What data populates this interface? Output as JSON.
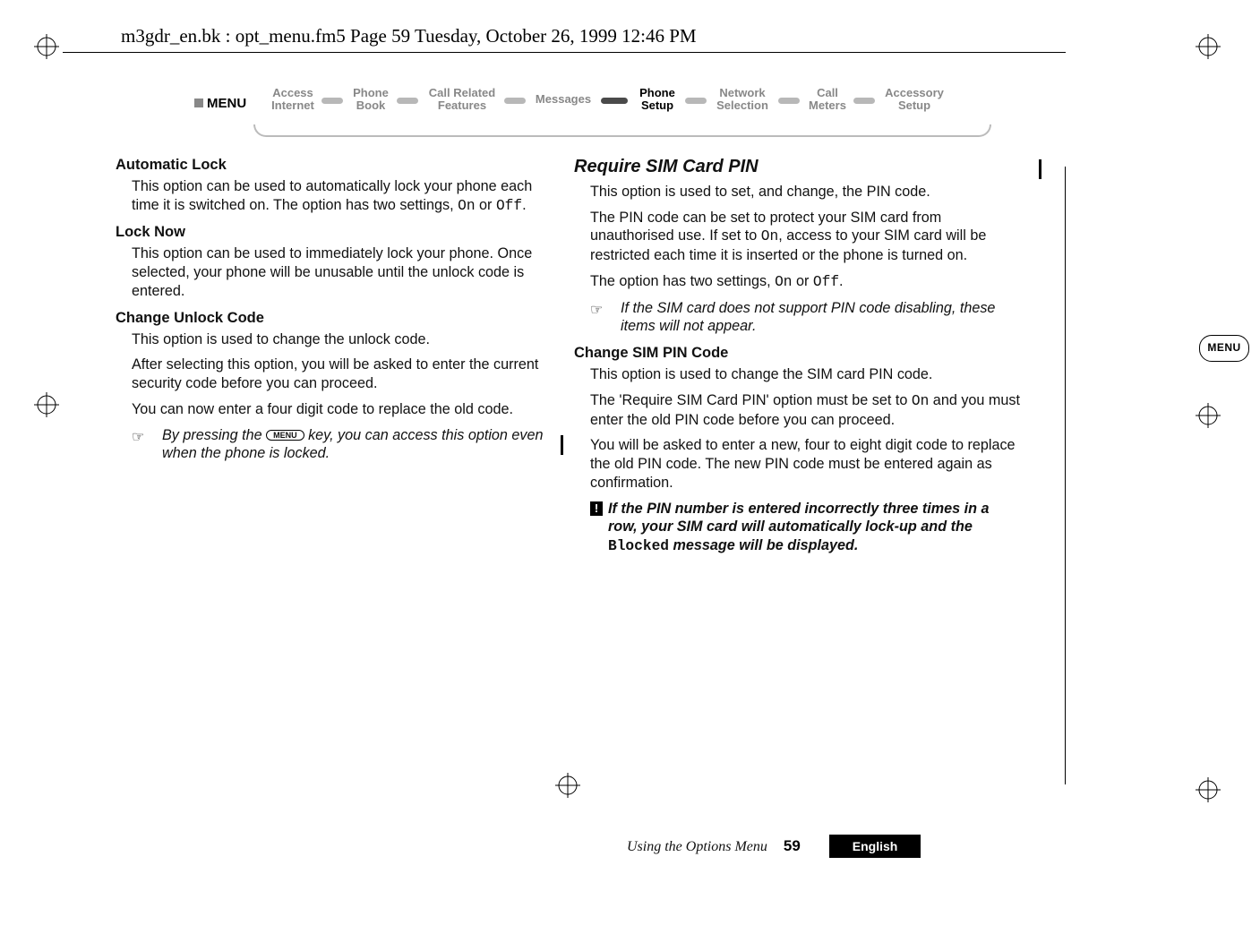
{
  "header": {
    "path_text": "m3gdr_en.bk : opt_menu.fm5  Page 59  Tuesday, October 26, 1999  12:46 PM"
  },
  "menubar": {
    "label": "MENU",
    "items": [
      {
        "l1": "Access",
        "l2": "Internet"
      },
      {
        "l1": "Phone",
        "l2": "Book"
      },
      {
        "l1": "Call Related",
        "l2": "Features"
      },
      {
        "l1": "Messages",
        "l2": ""
      },
      {
        "l1": "Phone",
        "l2": "Setup"
      },
      {
        "l1": "Network",
        "l2": "Selection"
      },
      {
        "l1": "Call",
        "l2": "Meters"
      },
      {
        "l1": "Accessory",
        "l2": "Setup"
      }
    ]
  },
  "left": {
    "h1": "Automatic Lock",
    "p1": "This option can be used to automatically lock your phone each time it is switched on. The option has two settings, ",
    "p1a": "On",
    "p1b": " or ",
    "p1c": "Off",
    "p1d": ".",
    "h2": "Lock Now",
    "p2": "This option can be used to immediately lock your phone. Once selected, your phone will be unusable until the unlock code is entered.",
    "h3": "Change Unlock Code",
    "p3": "This option is used to change the unlock code.",
    "p4": "After selecting this option, you will be asked to enter the current security code before you can proceed.",
    "p5": "You can now enter a four digit code to replace the old code.",
    "note_hand": "☞",
    "note_a": "By pressing the ",
    "note_key": "MENU",
    "note_b": " key, you can access this option even when the phone is locked."
  },
  "right": {
    "title": "Require SIM Card PIN",
    "p1": "This option is used to set, and change, the PIN code.",
    "p2a": "The PIN code can be set to protect your SIM card from unauthorised use. If set to ",
    "p2b": "On",
    "p2c": ", access to your SIM card will be restricted each time it is inserted or the phone is turned on.",
    "p3a": "The option has two settings, ",
    "p3b": "On",
    "p3c": " or ",
    "p3d": "Off",
    "p3e": ".",
    "note_hand": "☞",
    "note": "If the SIM card does not support PIN code disabling, these items will not appear.",
    "h2": "Change SIM PIN Code",
    "p4": "This option is used to change the SIM card PIN code.",
    "p5a": "The 'Require SIM Card PIN' option must be set to ",
    "p5b": "On",
    "p5c": " and you must enter the old PIN code before you can proceed.",
    "p6": "You will be asked to enter a new, four to eight digit code to replace the old PIN code. The new PIN code must be entered again as confirmation.",
    "warn_bang": "!",
    "warn_a": "If the PIN number is entered incorrectly three times in a row, your SIM card will automatically lock-up and the ",
    "warn_b": "Blocked",
    "warn_c": " message will be displayed."
  },
  "side_tab": "MENU",
  "footer": {
    "section": "Using the Options Menu",
    "page": "59",
    "lang": "English"
  }
}
